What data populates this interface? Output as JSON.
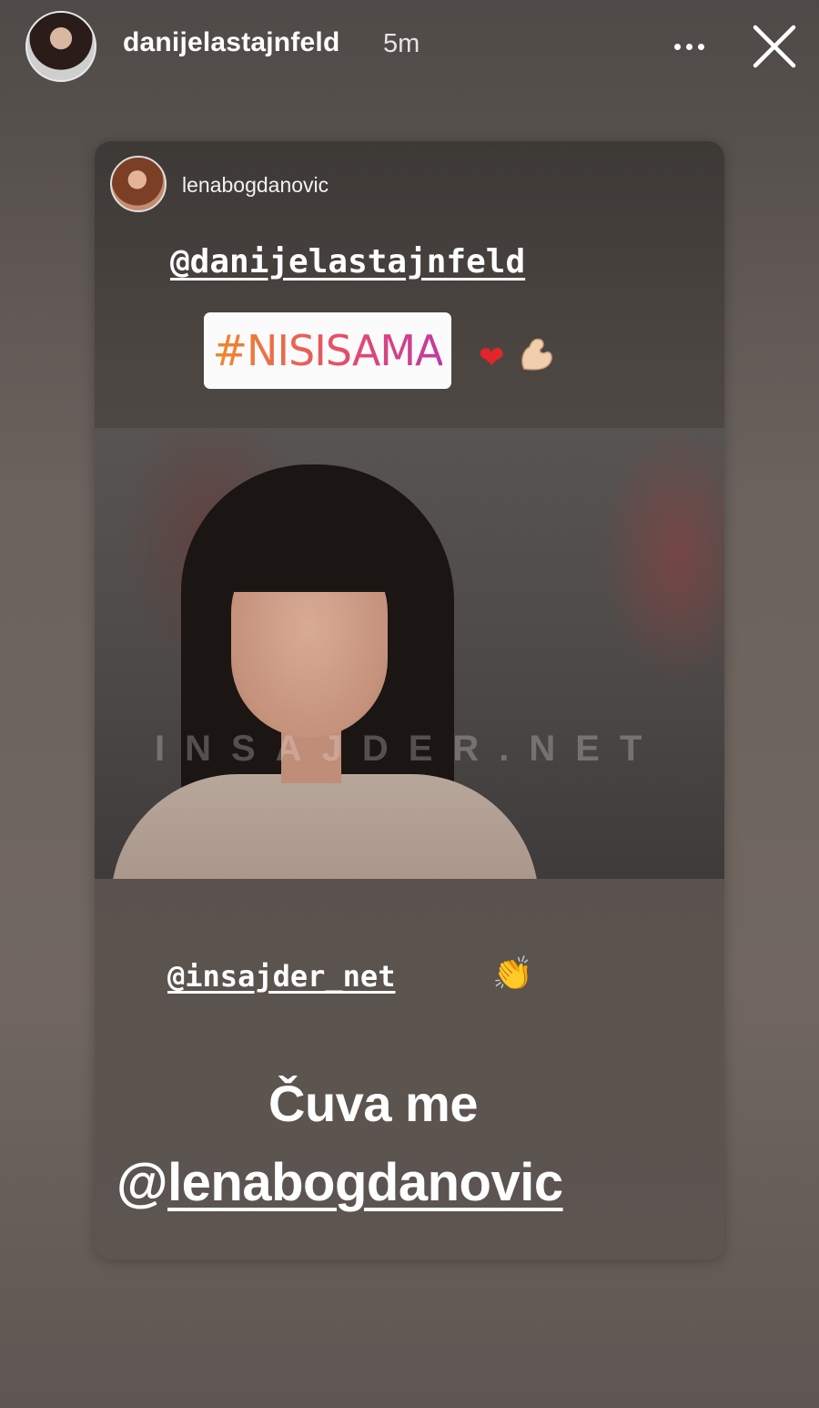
{
  "header": {
    "username": "danijelastajnfeld",
    "time": "5m",
    "avatar_icon": "profile-avatar",
    "more_icon": "more-dots-icon",
    "close_icon": "close-icon"
  },
  "shared_post": {
    "username": "lenabogdanovic",
    "mention_top": "@danijelastajnfeld",
    "hashtag": "#NISISAMA",
    "emoji_icons": [
      "heart-icon",
      "flexed-biceps-icon"
    ],
    "video_watermark": "INSAJDER.NET",
    "mention_bottom": "@insajder_net",
    "clap_icon": "clapping-hands-icon",
    "caption_line1": "Čuva me",
    "caption_at": "@",
    "caption_mention": "lenabogdanovic"
  },
  "colors": {
    "hashtag_gradient_start": "#f08a2a",
    "hashtag_gradient_end": "#c23aa0",
    "heart": "#e3242b"
  }
}
